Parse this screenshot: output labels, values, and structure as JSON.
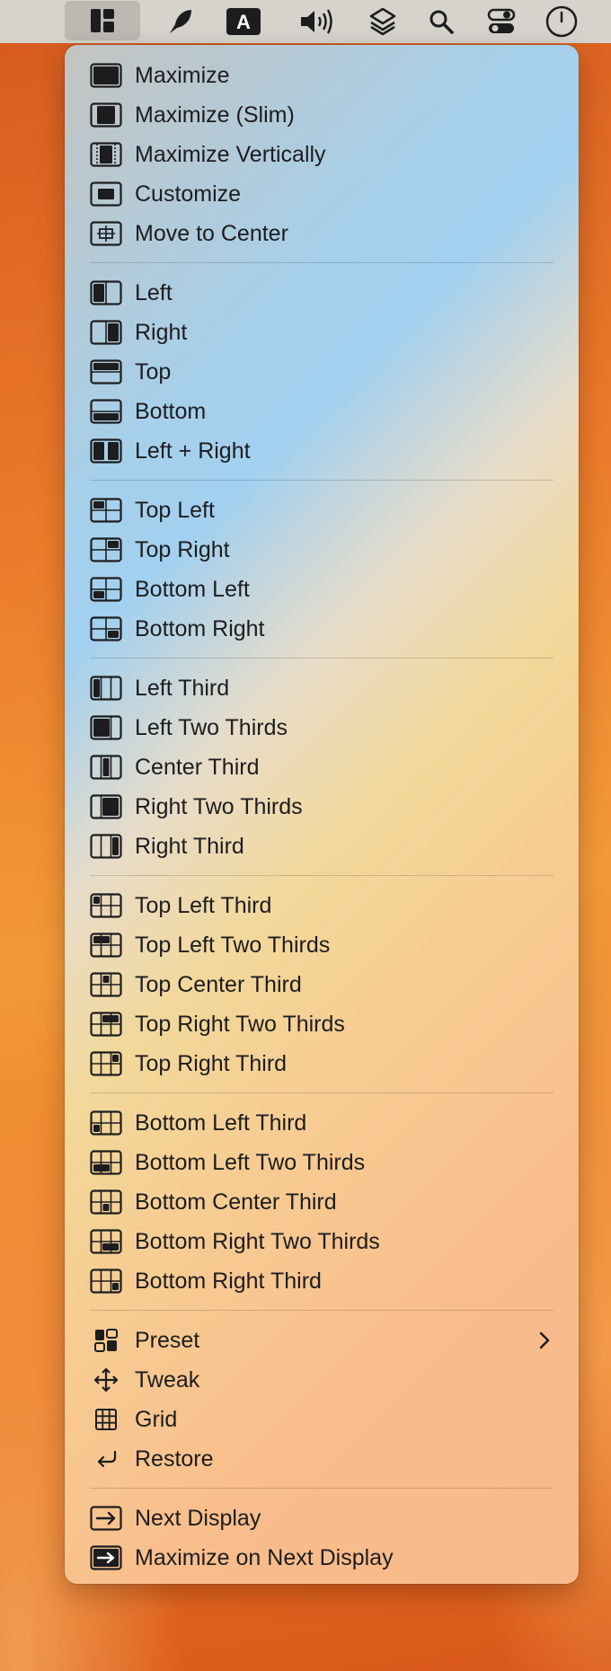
{
  "menubar": {
    "items": [
      {
        "icon": "window-layout-icon"
      },
      {
        "icon": "feather-icon"
      },
      {
        "icon": "text-input-a-icon",
        "label": "A"
      },
      {
        "icon": "volume-icon"
      },
      {
        "icon": "layers-icon"
      },
      {
        "icon": "search-icon"
      },
      {
        "icon": "control-center-icon"
      },
      {
        "icon": "clock-icon"
      }
    ]
  },
  "menu": {
    "groups": [
      [
        {
          "label": "Maximize",
          "icon": "maximize-icon"
        },
        {
          "label": "Maximize (Slim)",
          "icon": "maximize-slim-icon"
        },
        {
          "label": "Maximize Vertically",
          "icon": "maximize-vertically-icon"
        },
        {
          "label": "Customize",
          "icon": "customize-icon"
        },
        {
          "label": "Move to Center",
          "icon": "move-to-center-icon"
        }
      ],
      [
        {
          "label": "Left",
          "icon": "left-half-icon"
        },
        {
          "label": "Right",
          "icon": "right-half-icon"
        },
        {
          "label": "Top",
          "icon": "top-half-icon"
        },
        {
          "label": "Bottom",
          "icon": "bottom-half-icon"
        },
        {
          "label": "Left + Right",
          "icon": "left-right-icon"
        }
      ],
      [
        {
          "label": "Top Left",
          "icon": "top-left-quarter-icon"
        },
        {
          "label": "Top Right",
          "icon": "top-right-quarter-icon"
        },
        {
          "label": "Bottom Left",
          "icon": "bottom-left-quarter-icon"
        },
        {
          "label": "Bottom Right",
          "icon": "bottom-right-quarter-icon"
        }
      ],
      [
        {
          "label": "Left Third",
          "icon": "left-third-icon"
        },
        {
          "label": "Left Two Thirds",
          "icon": "left-two-thirds-icon"
        },
        {
          "label": "Center Third",
          "icon": "center-third-icon"
        },
        {
          "label": "Right Two Thirds",
          "icon": "right-two-thirds-icon"
        },
        {
          "label": "Right Third",
          "icon": "right-third-icon"
        }
      ],
      [
        {
          "label": "Top Left Third",
          "icon": "top-left-third-icon"
        },
        {
          "label": "Top Left Two Thirds",
          "icon": "top-left-two-thirds-icon"
        },
        {
          "label": "Top Center Third",
          "icon": "top-center-third-icon"
        },
        {
          "label": "Top Right Two Thirds",
          "icon": "top-right-two-thirds-icon"
        },
        {
          "label": "Top Right Third",
          "icon": "top-right-third-icon"
        }
      ],
      [
        {
          "label": "Bottom Left Third",
          "icon": "bottom-left-third-icon"
        },
        {
          "label": "Bottom Left Two Thirds",
          "icon": "bottom-left-two-thirds-icon"
        },
        {
          "label": "Bottom Center Third",
          "icon": "bottom-center-third-icon"
        },
        {
          "label": "Bottom Right Two Thirds",
          "icon": "bottom-right-two-thirds-icon"
        },
        {
          "label": "Bottom Right Third",
          "icon": "bottom-right-third-icon"
        }
      ],
      [
        {
          "label": "Preset",
          "icon": "preset-icon",
          "submenu": true
        },
        {
          "label": "Tweak",
          "icon": "tweak-arrows-icon"
        },
        {
          "label": "Grid",
          "icon": "grid-icon"
        },
        {
          "label": "Restore",
          "icon": "restore-icon"
        }
      ],
      [
        {
          "label": "Next Display",
          "icon": "next-display-icon"
        },
        {
          "label": "Maximize on Next Display",
          "icon": "maximize-next-display-icon"
        }
      ]
    ]
  },
  "colors": {
    "menu_text": "#1d1d1f",
    "menubar_bg": "#d6d3cd",
    "wallpaper": "#ec7a2a"
  }
}
